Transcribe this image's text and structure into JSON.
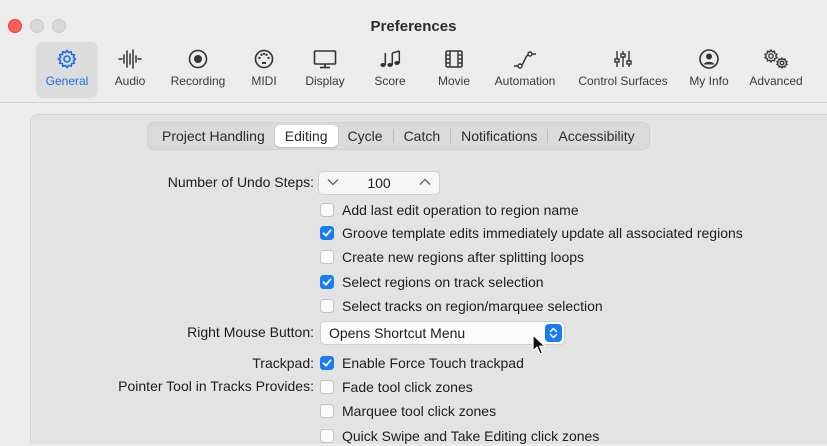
{
  "window": {
    "title": "Preferences"
  },
  "toolbar": {
    "items": [
      {
        "label": "General",
        "icon": "gear-icon",
        "active": true
      },
      {
        "label": "Audio",
        "icon": "waveform-icon"
      },
      {
        "label": "Recording",
        "icon": "record-icon"
      },
      {
        "label": "MIDI",
        "icon": "midi-port-icon"
      },
      {
        "label": "Display",
        "icon": "monitor-icon"
      },
      {
        "label": "Score",
        "icon": "music-notes-icon"
      },
      {
        "label": "Movie",
        "icon": "film-icon"
      },
      {
        "label": "Automation",
        "icon": "automation-curve-icon"
      },
      {
        "label": "Control Surfaces",
        "icon": "faders-icon"
      },
      {
        "label": "My Info",
        "icon": "person-icon"
      },
      {
        "label": "Advanced",
        "icon": "gears-icon"
      }
    ]
  },
  "tabs": {
    "items": [
      "Project Handling",
      "Editing",
      "Cycle",
      "Catch",
      "Notifications",
      "Accessibility"
    ],
    "selected": "Editing"
  },
  "editing": {
    "undo_label": "Number of Undo Steps:",
    "undo_value": "100",
    "checkboxes": [
      {
        "label": "Add last edit operation to region name",
        "checked": false
      },
      {
        "label": "Groove template edits immediately update all associated regions",
        "checked": true
      },
      {
        "label": "Create new regions after splitting loops",
        "checked": false
      },
      {
        "label": "Select regions on track selection",
        "checked": true
      },
      {
        "label": "Select tracks on region/marquee selection",
        "checked": false
      }
    ],
    "right_mouse_label": "Right Mouse Button:",
    "right_mouse_value": "Opens Shortcut Menu",
    "trackpad_label": "Trackpad:",
    "trackpad_option": {
      "label": "Enable Force Touch trackpad",
      "checked": true
    },
    "pointer_label": "Pointer Tool in Tracks Provides:",
    "pointer_options": [
      {
        "label": "Fade tool click zones",
        "checked": false
      },
      {
        "label": "Marquee tool click zones",
        "checked": false
      },
      {
        "label": "Quick Swipe and Take Editing click zones",
        "checked": false
      }
    ]
  },
  "colors": {
    "accent": "#1a7cf0",
    "active_toolbar_label": "#1a6fe6"
  }
}
